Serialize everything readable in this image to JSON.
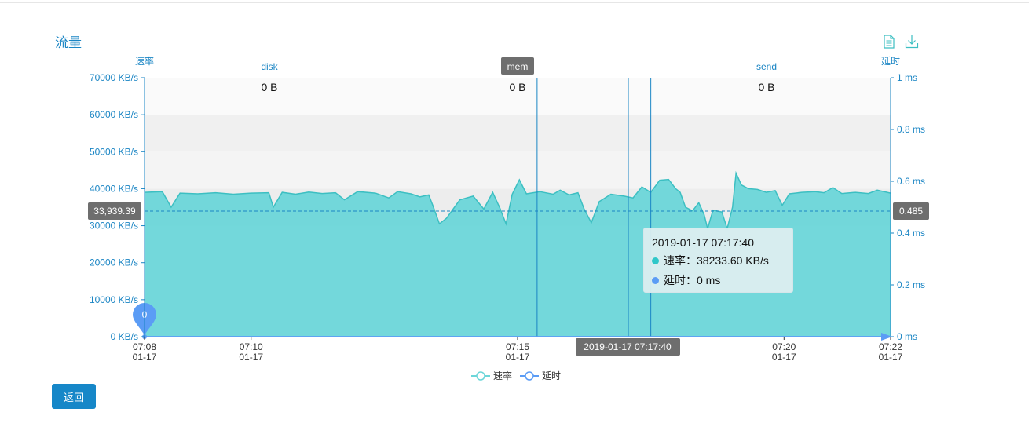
{
  "panel": {
    "title": "流量",
    "back_label": "返回"
  },
  "tools": {
    "data_view_icon": "document-icon",
    "save_icon": "download-icon"
  },
  "colors": {
    "area": "#6cd6d9",
    "line": "#3cbfc2",
    "axis": "#1a85c4",
    "marker": "#5b9cf5",
    "speed_dot": "#2ec7c9",
    "latency_dot": "#5b9cf5"
  },
  "chart_data": {
    "type": "area",
    "y_left_label": "速率",
    "y_right_label": "延时",
    "y_left_ticks": [
      "0 KB/s",
      "10000 KB/s",
      "20000 KB/s",
      "30000 KB/s",
      "40000 KB/s",
      "50000 KB/s",
      "60000 KB/s",
      "70000 KB/s"
    ],
    "y_right_ticks": [
      "0 ms",
      "0.2 ms",
      "0.4 ms",
      "0.6 ms",
      "0.8 ms",
      "1 ms"
    ],
    "ylim_left": [
      0,
      70000
    ],
    "ylim_right": [
      0,
      1
    ],
    "x_ticks": [
      {
        "t": 0,
        "time": "07:08",
        "date": "01-17"
      },
      {
        "t": 120,
        "time": "07:10",
        "date": "01-17"
      },
      {
        "t": 420,
        "time": "07:15",
        "date": "01-17"
      },
      {
        "t": 720,
        "time": "07:20",
        "date": "01-17"
      },
      {
        "t": 840,
        "time": "07:22",
        "date": "01-17"
      }
    ],
    "xlim": [
      0,
      840
    ],
    "series": [
      {
        "name": "速率",
        "points": [
          [
            0,
            39000
          ],
          [
            20,
            39200
          ],
          [
            30,
            35000
          ],
          [
            40,
            38800
          ],
          [
            60,
            38600
          ],
          [
            80,
            38900
          ],
          [
            100,
            38500
          ],
          [
            120,
            38800
          ],
          [
            140,
            38900
          ],
          [
            145,
            35000
          ],
          [
            155,
            39000
          ],
          [
            170,
            38500
          ],
          [
            185,
            39100
          ],
          [
            200,
            38700
          ],
          [
            215,
            38900
          ],
          [
            225,
            37000
          ],
          [
            240,
            39200
          ],
          [
            260,
            38800
          ],
          [
            275,
            37500
          ],
          [
            285,
            39200
          ],
          [
            300,
            38600
          ],
          [
            310,
            37800
          ],
          [
            320,
            38300
          ],
          [
            325,
            35200
          ],
          [
            332,
            30500
          ],
          [
            340,
            32000
          ],
          [
            355,
            37000
          ],
          [
            370,
            38000
          ],
          [
            382,
            34500
          ],
          [
            392,
            39000
          ],
          [
            400,
            34800
          ],
          [
            407,
            30500
          ],
          [
            414,
            38500
          ],
          [
            422,
            42400
          ],
          [
            430,
            38600
          ],
          [
            445,
            39200
          ],
          [
            460,
            38500
          ],
          [
            468,
            39600
          ],
          [
            478,
            38300
          ],
          [
            488,
            38900
          ],
          [
            495,
            34500
          ],
          [
            503,
            30800
          ],
          [
            512,
            36500
          ],
          [
            525,
            38500
          ],
          [
            540,
            38000
          ],
          [
            550,
            37500
          ],
          [
            560,
            40500
          ],
          [
            570,
            39000
          ],
          [
            580,
            42300
          ],
          [
            590,
            42500
          ],
          [
            598,
            40000
          ],
          [
            603,
            39000
          ],
          [
            609,
            35000
          ],
          [
            617,
            34000
          ],
          [
            624,
            36200
          ],
          [
            630,
            33000
          ],
          [
            634,
            29200
          ],
          [
            640,
            34200
          ],
          [
            650,
            33700
          ],
          [
            656,
            29200
          ],
          [
            662,
            35000
          ],
          [
            666,
            44200
          ],
          [
            672,
            41000
          ],
          [
            680,
            40000
          ],
          [
            690,
            39800
          ],
          [
            700,
            39000
          ],
          [
            710,
            39500
          ],
          [
            718,
            35500
          ],
          [
            726,
            38600
          ],
          [
            740,
            39000
          ],
          [
            755,
            39200
          ],
          [
            765,
            38900
          ],
          [
            775,
            40300
          ],
          [
            785,
            38700
          ],
          [
            800,
            39000
          ],
          [
            815,
            38700
          ],
          [
            825,
            39600
          ],
          [
            840,
            38800
          ]
        ]
      },
      {
        "name": "延时",
        "points": [
          [
            0,
            0
          ],
          [
            840,
            0
          ]
        ]
      }
    ],
    "markers": [
      {
        "type": "point",
        "x": 0,
        "label": "0"
      }
    ],
    "average_line": {
      "left_value": "33,939.39",
      "right_value": "0.485"
    },
    "mark_lines": [
      {
        "label": "disk",
        "value": "0 B",
        "x": null
      },
      {
        "label": "mem",
        "value": "0 B",
        "x": 442
      },
      {
        "label": "send",
        "value": "0 B",
        "x": 570
      }
    ],
    "cursor_label": "2019-01-17 07:17:40",
    "tooltip": {
      "time": "2019-01-17 07:17:40",
      "rows": [
        {
          "label": "速率：",
          "value": "38233.60 KB/s"
        },
        {
          "label": "延时：",
          "value": "0 ms"
        }
      ]
    },
    "legend": [
      "速率",
      "延时"
    ],
    "legend_position": "bottom-center",
    "grid": false
  }
}
